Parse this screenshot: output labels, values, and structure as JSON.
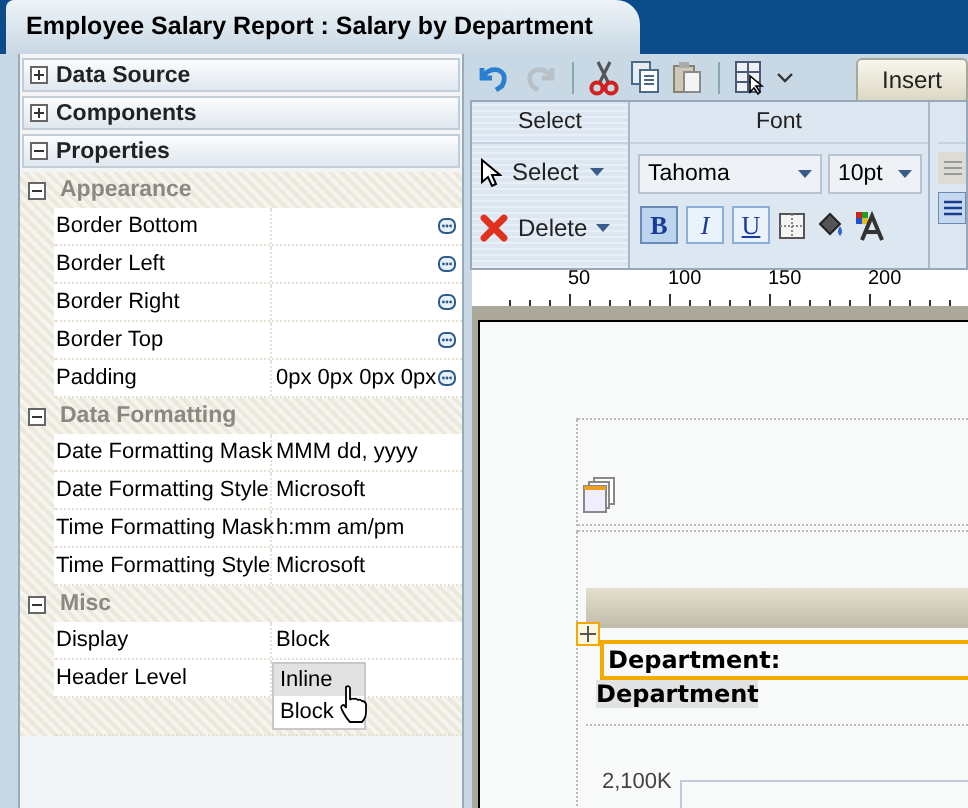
{
  "window": {
    "title": "Employee Salary Report : Salary by Department"
  },
  "panels": [
    {
      "label": "Data Source",
      "expanded": false
    },
    {
      "label": "Components",
      "expanded": false
    },
    {
      "label": "Properties",
      "expanded": true
    }
  ],
  "groups": [
    {
      "label": "Appearance",
      "expanded": true,
      "rows": [
        {
          "name": "Border Bottom",
          "kind": "button"
        },
        {
          "name": "Border Left",
          "kind": "button"
        },
        {
          "name": "Border Right",
          "kind": "button"
        },
        {
          "name": "Border Top",
          "kind": "button"
        },
        {
          "name": "Padding",
          "value": "0px 0px 0px 0px",
          "kind": "button"
        }
      ]
    },
    {
      "label": "Data Formatting",
      "expanded": true,
      "rows": [
        {
          "name": "Date Formatting Mask",
          "value": "MMM dd, yyyy",
          "kind": "text"
        },
        {
          "name": "Date Formatting Style",
          "value": "Microsoft",
          "kind": "text"
        },
        {
          "name": "Time Formatting Mask",
          "value": "h:mm am/pm",
          "kind": "text"
        },
        {
          "name": "Time Formatting Style",
          "value": "Microsoft",
          "kind": "text"
        }
      ]
    },
    {
      "label": "Misc",
      "expanded": true,
      "rows": [
        {
          "name": "Display",
          "value": "Block",
          "kind": "text"
        },
        {
          "name": "Header Level",
          "kind": "dropdown",
          "options": [
            {
              "label": "Inline",
              "selected": true
            },
            {
              "label": "Block",
              "selected": false
            }
          ]
        }
      ]
    }
  ],
  "tabs": [
    {
      "label": "Insert",
      "selected": false
    }
  ],
  "ribbon": {
    "select_group": {
      "title": "Select",
      "buttons": [
        "Select",
        "Delete"
      ]
    },
    "font_group": {
      "title": "Font",
      "font": "Tahoma",
      "size": "10pt",
      "styles": [
        {
          "label": "B",
          "on": true
        },
        {
          "label": "I",
          "on": false
        },
        {
          "label": "U",
          "on": false
        }
      ]
    }
  },
  "ruler": [
    "50",
    "100",
    "150",
    "200"
  ],
  "canvas": {
    "field_label": "Department:",
    "field_value": "Department",
    "axis_label": "2,100K"
  }
}
